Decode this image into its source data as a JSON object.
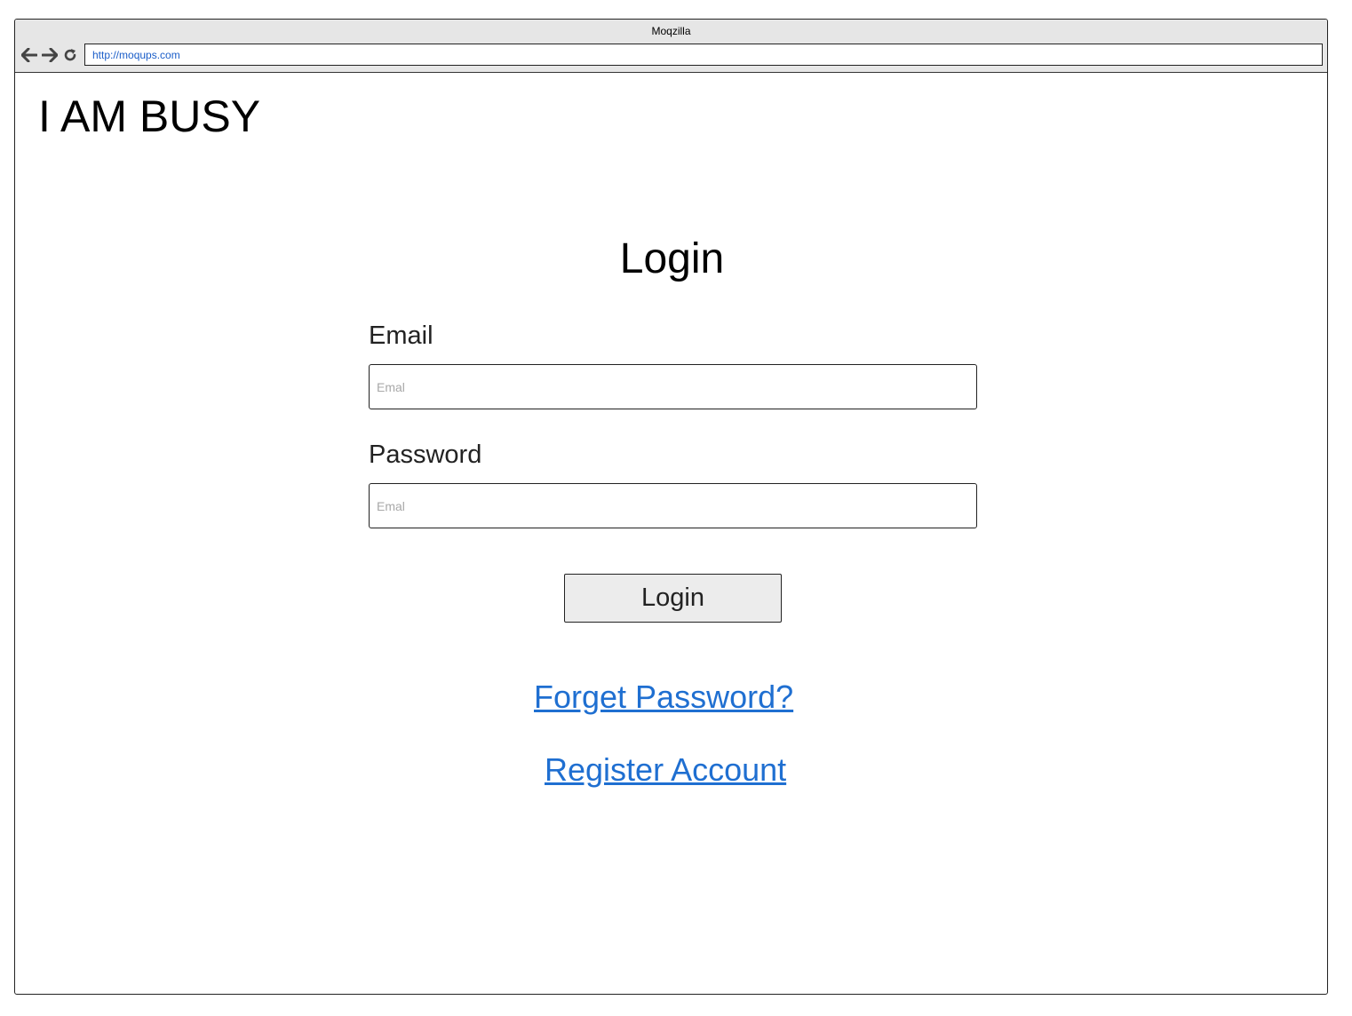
{
  "window": {
    "title": "Moqzilla"
  },
  "toolbar": {
    "url": "http://moqups.com",
    "back_icon": "arrow-left-icon",
    "forward_icon": "arrow-right-icon",
    "reload_icon": "reload-icon"
  },
  "page": {
    "brand": "I AM BUSY",
    "heading": "Login",
    "email": {
      "label": "Email",
      "placeholder": "Emal",
      "value": ""
    },
    "password": {
      "label": "Password",
      "placeholder": "Emal",
      "value": ""
    },
    "login_button": "Login",
    "forgot_link": "Forget Password?",
    "register_link": "Register Account"
  },
  "colors": {
    "link": "#1f6fd1",
    "chrome_bg": "#e6e6e6",
    "button_bg": "#ececec"
  }
}
